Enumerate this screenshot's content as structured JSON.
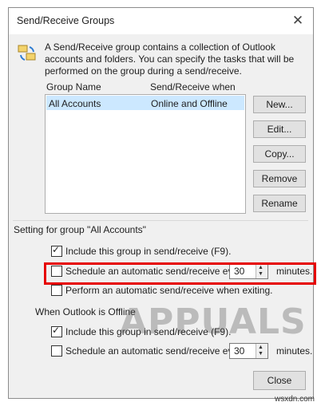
{
  "window": {
    "title": "Send/Receive Groups",
    "close_glyph": "✕"
  },
  "description": "A Send/Receive group contains a collection of Outlook accounts and folders. You can specify the tasks that will be performed on the group during a send/receive.",
  "list": {
    "headers": {
      "name": "Group Name",
      "when": "Send/Receive when"
    },
    "rows": [
      {
        "name": "All Accounts",
        "when": "Online and Offline"
      }
    ]
  },
  "buttons": {
    "new": "New...",
    "edit": "Edit...",
    "copy": "Copy...",
    "remove": "Remove",
    "rename": "Rename",
    "close": "Close"
  },
  "online_section": {
    "title": "Setting for group \"All Accounts\"",
    "include": {
      "label": "Include this group in send/receive (F9).",
      "checked": true
    },
    "schedule": {
      "label": "Schedule an automatic send/receive every",
      "checked": false,
      "value": "30",
      "unit": "minutes."
    },
    "exit": {
      "label": "Perform an automatic send/receive when exiting.",
      "checked": false
    }
  },
  "offline_section": {
    "title": "When Outlook is Offline",
    "include": {
      "label": "Include this group in send/receive (F9).",
      "checked": true
    },
    "schedule": {
      "label": "Schedule an automatic send/receive every",
      "checked": false,
      "value": "30",
      "unit": "minutes."
    }
  },
  "watermark": "APPUALS",
  "corner_text": "wsxdn.com",
  "colors": {
    "highlight": "#e60000",
    "selection": "#cce8ff"
  }
}
